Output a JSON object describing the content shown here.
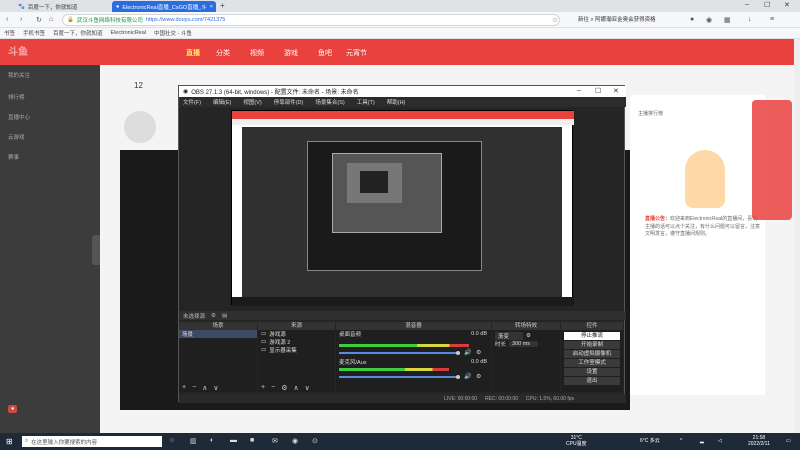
{
  "browser": {
    "tab1": "百度一下，你就知道",
    "tab2": "ElectronicReal直播_CsGO直播_斗",
    "site_name": "武汉斗鱼网络科技有限公司",
    "url": "https://www.douyu.com/7421375",
    "search_label": "新往",
    "search_text": "阿娜瀚亚金奥会获得资格",
    "bookmarks": [
      "书签",
      "手机书签",
      "百度一下，你就知道",
      "ElectronicReal",
      "中国社交 - 斗鱼"
    ]
  },
  "site": {
    "nav_items": [
      "直播",
      "分类",
      "视频",
      "游戏",
      "鱼吧",
      "元宵节"
    ],
    "active_nav": "直播",
    "sidebar_items": [
      "我的关注",
      "排行榜",
      "直播中心",
      "云游戏",
      "赛事"
    ],
    "sidebar_counts": [
      "12"
    ],
    "right_panel_title": "主播排行榜",
    "announcement_label": "直播公告：",
    "announcement": "欢迎来到ElectronicReal的直播间，喜欢主播的话可以点个关注，有什么问题可以留言，注意文明发言，遵守直播间规则。"
  },
  "obs": {
    "title": "OBS 27.1.3 (64-bit, windows) - 配置文件: 未命名 - 场景: 未命名",
    "menu": [
      "文件(F)",
      "编辑(E)",
      "视图(V)",
      "停靠部件(D)",
      "场景集合(S)",
      "工具(T)",
      "帮助(H)"
    ],
    "status_text": "未选择源",
    "scenes_header": "场景",
    "scenes": [
      "场景"
    ],
    "sources_header": "来源",
    "sources": [
      "游戏源",
      "游戏源 2",
      "显示器采集"
    ],
    "mixer_header": "混音器",
    "mixer_channels": [
      {
        "name": "桌面音频",
        "db": "0.0 dB"
      },
      {
        "name": "麦克风/Aux",
        "db": "0.0 dB"
      }
    ],
    "transitions_header": "转场特效",
    "transition": "渐变",
    "duration_label": "时长",
    "duration": "300 ms",
    "controls_header": "控件",
    "controls": [
      "停止推流",
      "开始录制",
      "启动虚拟摄像机",
      "工作室模式",
      "设置",
      "退出"
    ],
    "statusbar": {
      "live": "LIVE: 00:00:00",
      "rec": "REC: 00:00:00",
      "cpu": "CPU: 1.5%, 60.00 fps"
    }
  },
  "taskbar": {
    "search_placeholder": "在这里输入你要搜索的内容",
    "weather": "31°C",
    "weather_desc": "CPU温度",
    "temp": "6°C 多云",
    "time": "21:58",
    "date": "2022/2/11"
  }
}
